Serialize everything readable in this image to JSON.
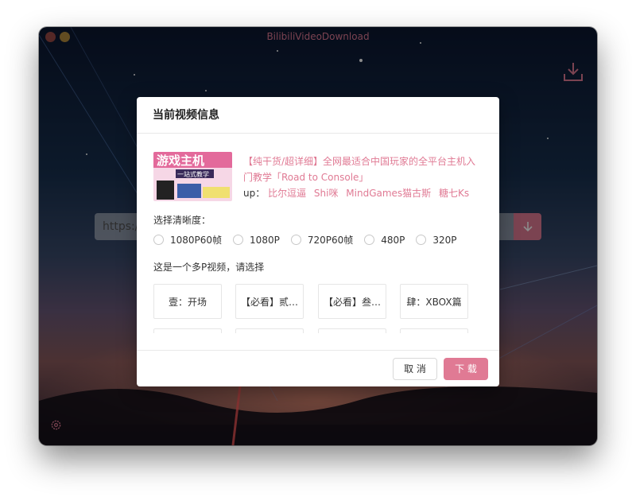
{
  "window": {
    "title": "BilibiliVideoDownload",
    "accent_color": "#e07a94"
  },
  "main": {
    "url_placeholder": "https:/",
    "download_icon": "download-tray-icon",
    "settings_icon": "gear-icon",
    "submit_icon": "arrow-down-icon"
  },
  "modal": {
    "title": "当前视频信息",
    "video": {
      "thumbnail_text_top": "游戏主机",
      "thumbnail_text_bottom": "一站式教学",
      "title": "【纯干货/超详细】全网最适合中国玩家的全平台主机入门教学「Road to Console」",
      "up_label": "up：",
      "uploaders": [
        "比尔逗逼",
        "Shi咪",
        "MindGames猫古斯",
        "糖七Ks"
      ]
    },
    "quality_label": "选择清晰度：",
    "qualities": [
      "1080P60帧",
      "1080P",
      "720P60帧",
      "480P",
      "320P"
    ],
    "multi_p_label": "这是一个多P视频，请选择",
    "parts": [
      "壹：开场",
      "【必看】贰…",
      "【必看】叁…",
      "肆：XBOX篇"
    ],
    "cancel_label": "取 消",
    "download_label": "下 载"
  }
}
